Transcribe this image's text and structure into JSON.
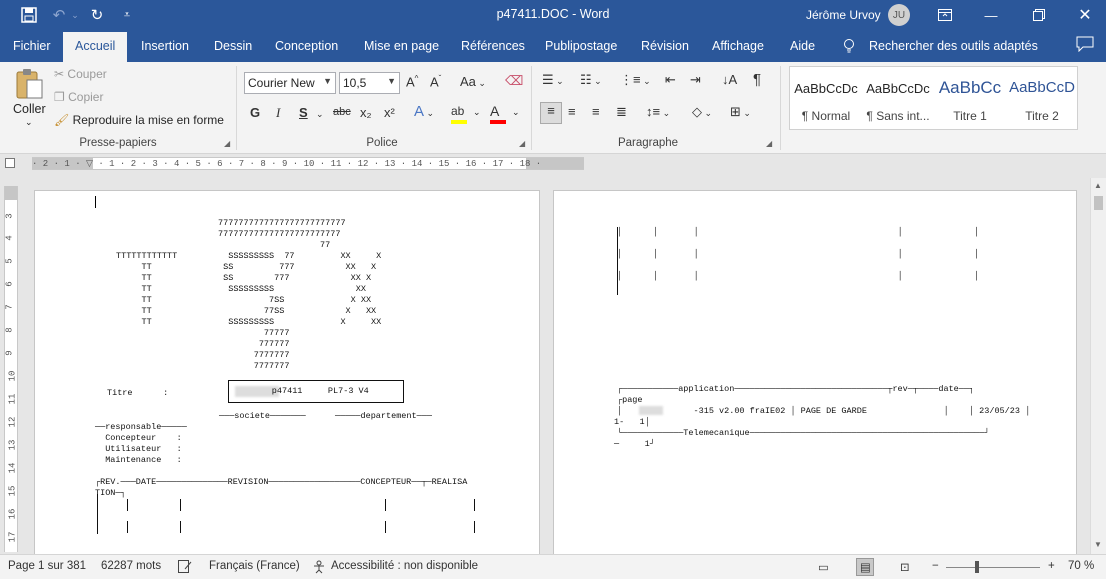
{
  "titlebar": {
    "doc_title": "p47411.DOC  -  Word",
    "user_name": "Jérôme Urvoy",
    "user_initials": "JU"
  },
  "tabs": {
    "file": "Fichier",
    "home": "Accueil",
    "insert": "Insertion",
    "draw": "Dessin",
    "design": "Conception",
    "layout": "Mise en page",
    "references": "Références",
    "mailings": "Publipostage",
    "review": "Révision",
    "view": "Affichage",
    "help": "Aide",
    "search": "Rechercher des outils adaptés"
  },
  "clipboard": {
    "paste": "Coller",
    "cut": "Couper",
    "copy": "Copier",
    "format_painter": "Reproduire la mise en forme",
    "label": "Presse-papiers"
  },
  "font": {
    "name": "Courier New",
    "size": "10,5",
    "label": "Police",
    "bold": "G",
    "italic": "I",
    "underline": "S",
    "strike": "abc",
    "subscript": "x₂",
    "superscript": "x²",
    "grow": "A^",
    "shrink": "Aˇ",
    "case": "Aa"
  },
  "paragraph": {
    "label": "Paragraphe"
  },
  "styles": [
    {
      "preview": "AaBbCcDc",
      "name": "¶ Normal"
    },
    {
      "preview": "AaBbCcDc",
      "name": "¶ Sans int..."
    },
    {
      "preview": "AaBbCc",
      "name": "Titre 1"
    },
    {
      "preview": "AaBbCcD",
      "name": "Titre 2"
    }
  ],
  "colors": {
    "accent": "#2b579a",
    "highlight": "#ffff00",
    "font_color": "#ff0000"
  },
  "ruler": {
    "text": "· 2 · 1 · ▽ · 1 · 2 · 3 · 4 · 5 · 6 · 7 · 8 · 9 · 10 · 11 · 12 · 13 · 14 · 15 · 16 · 17 · 18 ·"
  },
  "vruler": [
    "3",
    "4",
    "5",
    "6",
    "7",
    "8",
    "9",
    "10",
    "11",
    "12",
    "13",
    "14",
    "15",
    "16",
    "17",
    "1"
  ],
  "page1": {
    "line01": "                              7777777777777777777777777",
    "line02": "                              777777777777777777777777",
    "line03": "                                                  77",
    "line04": "          TTTTTTTTTTTT          SSSSSSSSS  77         XX     X",
    "line05": "               TT              SS         777          XX   X",
    "line06": "               TT              SS        777            XX X",
    "line07": "               TT               SSSSSSSSS                XX",
    "line08": "               TT                       7SS             X XX",
    "line09": "               TT                      77SS            X   XX",
    "line10": "               TT               SSSSSSSSS             X     XX",
    "line11": "                                       77777",
    "line12": "                                      777777",
    "line13": "                                     7777777",
    "line14": "                                     7777777",
    "titre_label": "Titre      :",
    "titre_value": "        p47411     PL7-3 V4",
    "societe": "───societe───────",
    "departement": "─────departement───",
    "responsable": "──responsable─────",
    "concepteur": "  Concepteur    :",
    "utilisateur": "  Utilisateur   :",
    "maintenance": "  Maintenance   :",
    "rev_header": "┌REV.───DATE──────────────REVISION──────────────────CONCEPTEUR──┬─REALISA",
    "tion": "TION─┐"
  },
  "page2": {
    "row1": "│      │       │                                       │              │",
    "row2": "│      │       │                                       │              │",
    "row3": "│      │       │                                       │              │",
    "app_header": "┌───────────application──────────────────────────────┬rev─┬────date──┐",
    "page_label": "┌page",
    "app_row": "│              -315 v2.00 fraIE02 │ PAGE DE GARDE               │    │ 23/05/23 │",
    "page_num": "1-   1│",
    "tele": "└────────────Telemecanique──────────────────────────────────────────────┘",
    "page_tail": "─     1┘"
  },
  "status": {
    "page": "Page 1 sur 381",
    "words": "62287 mots",
    "language": "Français (France)",
    "accessibility": "Accessibilité : non disponible",
    "zoom": "70 %"
  }
}
